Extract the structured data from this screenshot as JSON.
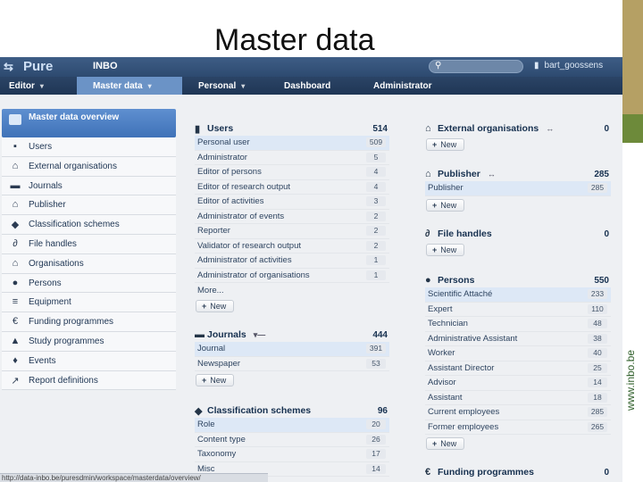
{
  "slide": {
    "title": "Master data"
  },
  "app": {
    "logo": "Pure",
    "org": "INBO",
    "user": "bart_goossens",
    "nav": [
      {
        "label": "Editor",
        "caret": true,
        "active": false
      },
      {
        "label": "Master data",
        "caret": true,
        "active": true
      },
      {
        "label": "Personal",
        "caret": true,
        "active": false
      },
      {
        "label": "Dashboard",
        "caret": false,
        "active": false
      },
      {
        "label": "Administrator",
        "caret": false,
        "active": false
      }
    ]
  },
  "sidebar": {
    "head": "Master data overview",
    "items": [
      {
        "label": "Users",
        "icon": "user-icon",
        "glyph": "▪"
      },
      {
        "label": "External organisations",
        "icon": "building-icon",
        "glyph": "⌂"
      },
      {
        "label": "Journals",
        "icon": "book-icon",
        "glyph": "▬"
      },
      {
        "label": "Publisher",
        "icon": "publisher-icon",
        "glyph": "⌂"
      },
      {
        "label": "Classification schemes",
        "icon": "tag-icon",
        "glyph": "◆"
      },
      {
        "label": "File handles",
        "icon": "paperclip-icon",
        "glyph": "∂"
      },
      {
        "label": "Organisations",
        "icon": "organisation-icon",
        "glyph": "⌂"
      },
      {
        "label": "Persons",
        "icon": "person-icon",
        "glyph": "●"
      },
      {
        "label": "Equipment",
        "icon": "equipment-icon",
        "glyph": "≡"
      },
      {
        "label": "Funding programmes",
        "icon": "euro-icon",
        "glyph": "€"
      },
      {
        "label": "Study programmes",
        "icon": "graduation-icon",
        "glyph": "▲"
      },
      {
        "label": "Events",
        "icon": "events-icon",
        "glyph": "♦"
      },
      {
        "label": "Report definitions",
        "icon": "report-icon",
        "glyph": "↗"
      }
    ]
  },
  "panels": {
    "users": {
      "title": "Users",
      "count": "514",
      "rows": [
        {
          "label": "Personal user",
          "value": "509"
        },
        {
          "label": "Administrator",
          "value": "5"
        },
        {
          "label": "Editor of persons",
          "value": "4"
        },
        {
          "label": "Editor of research output",
          "value": "4"
        },
        {
          "label": "Editor of activities",
          "value": "3"
        },
        {
          "label": "Administrator of events",
          "value": "2"
        },
        {
          "label": "Reporter",
          "value": "2"
        },
        {
          "label": "Validator of research output",
          "value": "2"
        },
        {
          "label": "Administrator of activities",
          "value": "1"
        },
        {
          "label": "Administrator of organisations",
          "value": "1"
        }
      ],
      "more": "More...",
      "new": "New"
    },
    "journals": {
      "title": "Journals",
      "count": "444",
      "sort": "▾—",
      "rows": [
        {
          "label": "Journal",
          "value": "391"
        },
        {
          "label": "Newspaper",
          "value": "53"
        }
      ],
      "new": "New"
    },
    "classification": {
      "title": "Classification schemes",
      "count": "96",
      "rows": [
        {
          "label": "Role",
          "value": "20"
        },
        {
          "label": "Content type",
          "value": "26"
        },
        {
          "label": "Taxonomy",
          "value": "17"
        },
        {
          "label": "Misc",
          "value": "14"
        }
      ]
    },
    "external": {
      "title": "External organisations",
      "count": "0",
      "sort": "↔",
      "new": "New"
    },
    "publisher": {
      "title": "Publisher",
      "count": "285",
      "sort": "↔",
      "rows": [
        {
          "label": "Publisher",
          "value": "285"
        }
      ],
      "new": "New"
    },
    "filehandles": {
      "title": "File handles",
      "count": "0",
      "new": "New"
    },
    "persons": {
      "title": "Persons",
      "count": "550",
      "rows": [
        {
          "label": "Scientific Attaché",
          "value": "233"
        },
        {
          "label": "Expert",
          "value": "110"
        },
        {
          "label": "Technician",
          "value": "48"
        },
        {
          "label": "Administrative Assistant",
          "value": "38"
        },
        {
          "label": "Worker",
          "value": "40"
        },
        {
          "label": "Assistant Director",
          "value": "25"
        },
        {
          "label": "Advisor",
          "value": "14"
        },
        {
          "label": "Assistant",
          "value": "18"
        },
        {
          "label": "Current employees",
          "value": "285"
        },
        {
          "label": "Former employees",
          "value": "265"
        }
      ],
      "new": "New"
    },
    "funding": {
      "title": "Funding programmes",
      "count": "0"
    }
  },
  "statusbar": "http://data-inbo.be/puresdmin/workspace/masterdata/overview/",
  "branding": {
    "side_text": "www.inbo.be"
  },
  "colors": {
    "nav_active": "#6b93c6",
    "topbar": "#2d4a70",
    "accent_strip": "#b5a064"
  }
}
